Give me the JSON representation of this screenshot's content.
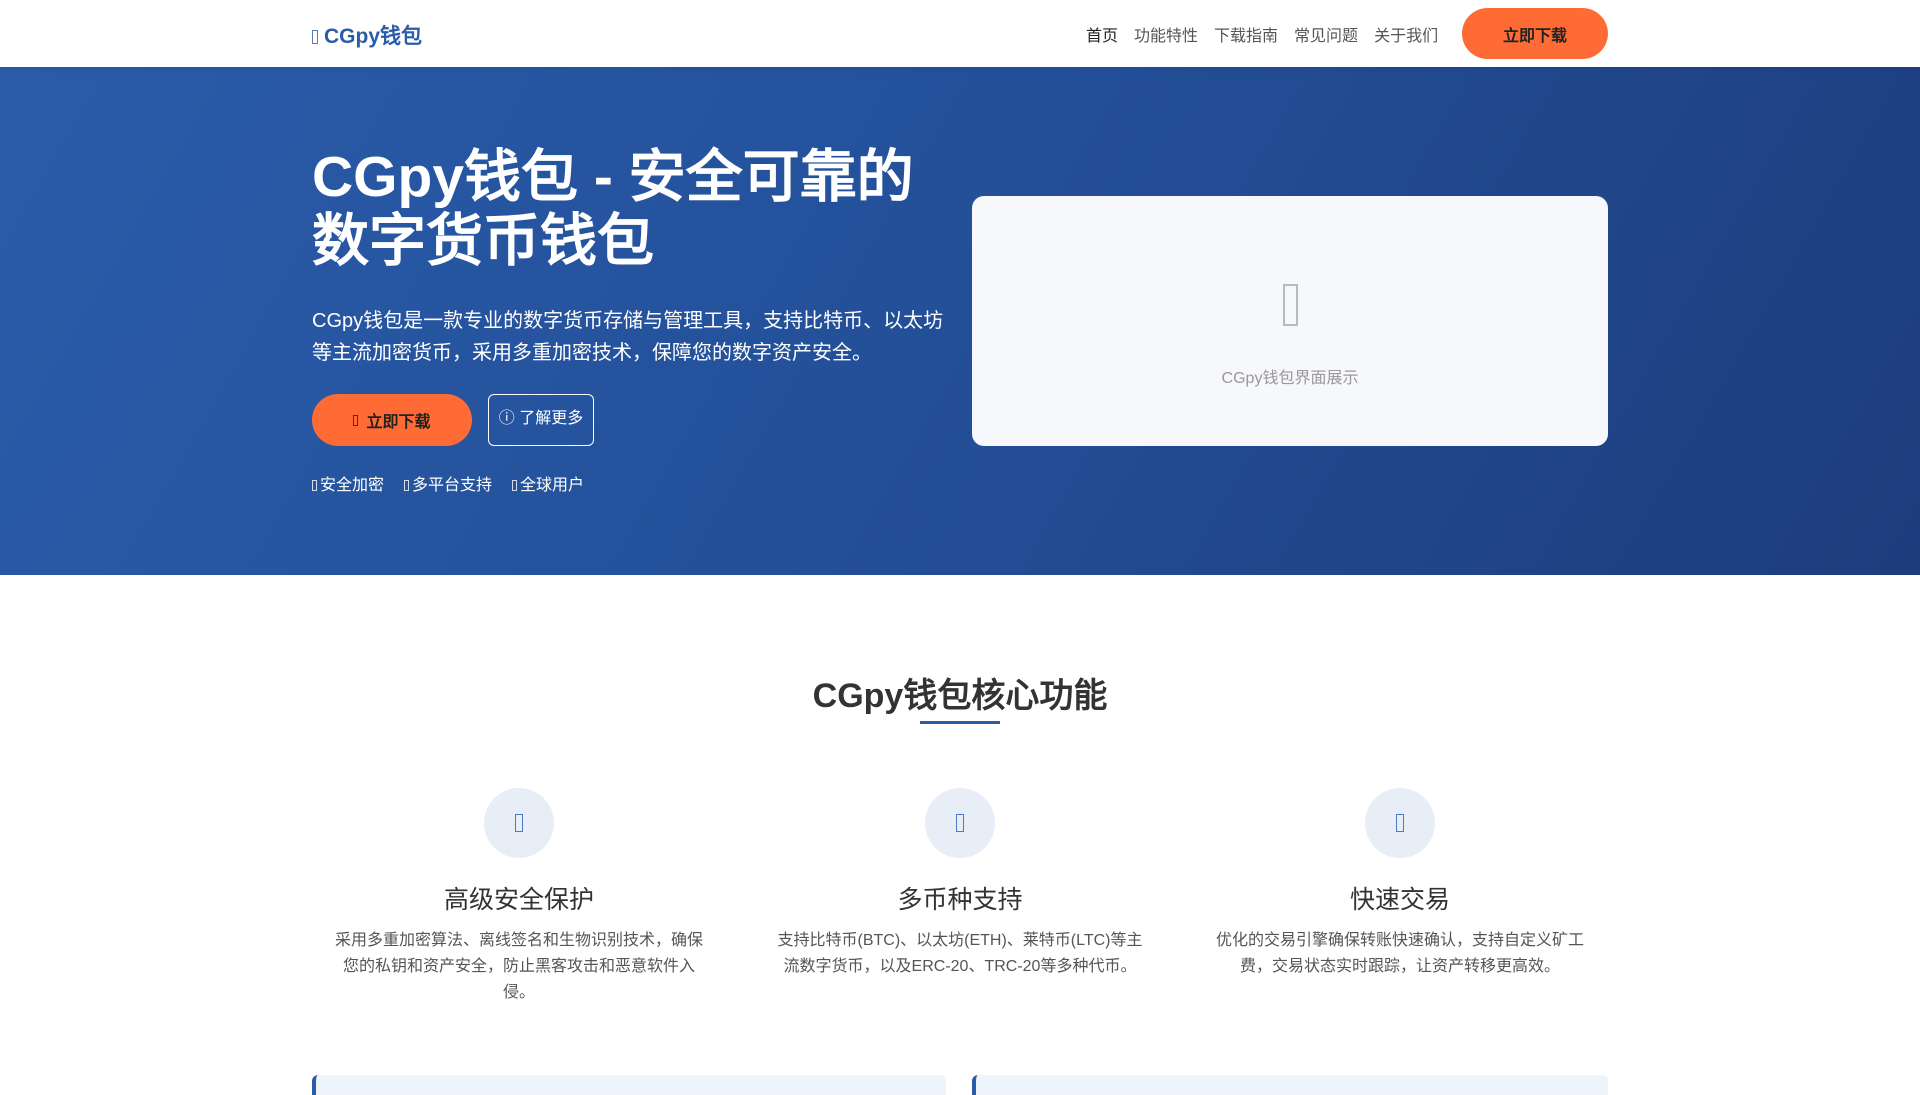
{
  "header": {
    "logo": "CGpy钱包",
    "nav": [
      "首页",
      "功能特性",
      "下载指南",
      "常见问题",
      "关于我们"
    ],
    "download": "立即下载"
  },
  "hero": {
    "title": "CGpy钱包 - 安全可靠的数字货币钱包",
    "description": "CGpy钱包是一款专业的数字货币存储与管理工具，支持比特币、以太坊等主流加密货币，采用多重加密技术，保障您的数字资产安全。",
    "primary_button": "立即下载",
    "secondary_button": "了解更多",
    "features": [
      "安全加密",
      "多平台支持",
      "全球用户"
    ],
    "image_caption": "CGpy钱包界面展示"
  },
  "features": {
    "title": "CGpy钱包核心功能",
    "items": [
      {
        "title": "高级安全保护",
        "desc": "采用多重加密算法、离线签名和生物识别技术，确保您的私钥和资产安全，防止黑客攻击和恶意软件入侵。"
      },
      {
        "title": "多币种支持",
        "desc": "支持比特币(BTC)、以太坊(ETH)、莱特币(LTC)等主流数字货币，以及ERC-20、TRC-20等多种代币。"
      },
      {
        "title": "快速交易",
        "desc": "优化的交易引擎确保转账快速确认，支持自定义矿工费，交易状态实时跟踪，让资产转移更高效。"
      }
    ]
  },
  "colors": {
    "brand": "#2a5caa",
    "accent": "#ff6b35"
  }
}
